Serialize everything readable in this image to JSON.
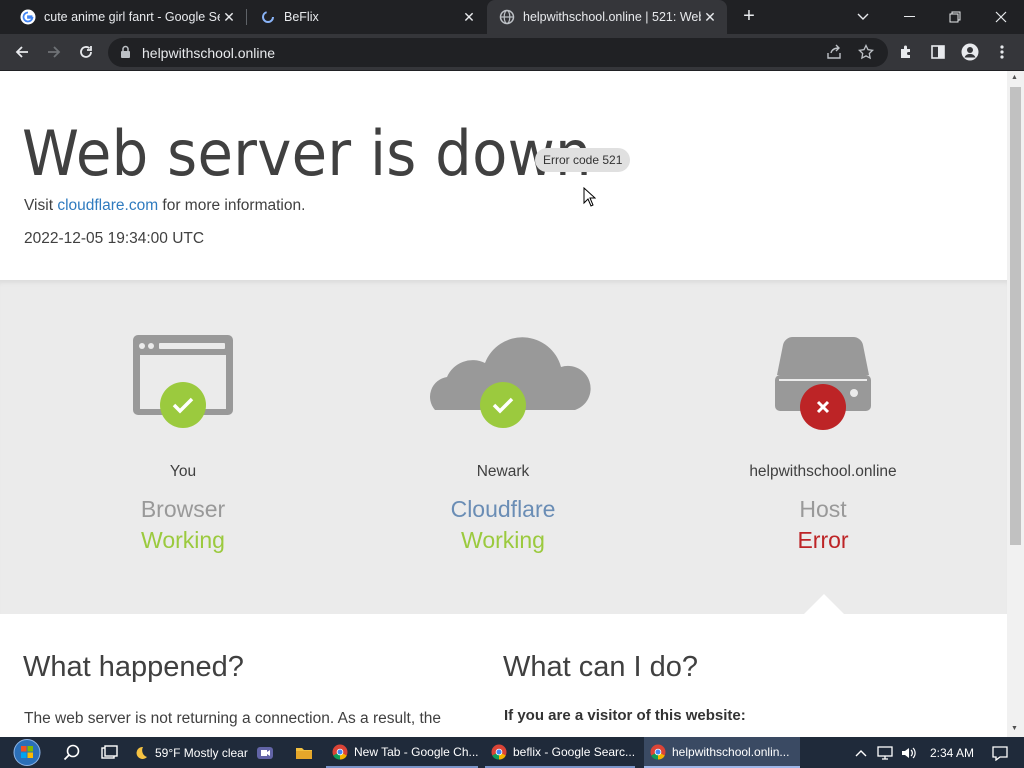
{
  "browser": {
    "tabs": [
      {
        "title": "cute anime girl fanrt - Google Se",
        "close": "✕"
      },
      {
        "title": "BeFlix",
        "close": "✕"
      },
      {
        "title": "helpwithschool.online | 521: Web",
        "close": "✕"
      }
    ],
    "new_tab": "+",
    "url": "helpwithschool.online"
  },
  "page": {
    "heading": "Web server is down",
    "error_badge": "Error code 521",
    "visit_prefix": "Visit ",
    "visit_link": "cloudflare.com",
    "visit_suffix": " for more information.",
    "timestamp": "2022-12-05 19:34:00 UTC",
    "status": [
      {
        "location": "You",
        "kind": "Browser",
        "state": "Working",
        "state_color": "#9bca3e"
      },
      {
        "location": "Newark",
        "kind": "Cloudflare",
        "state": "Working",
        "state_color": "#9bca3e"
      },
      {
        "location": "helpwithschool.online",
        "kind": "Host",
        "state": "Error",
        "state_color": "#bd2426"
      }
    ],
    "what_happened_title": "What happened?",
    "what_happened_text": "The web server is not returning a connection. As a result, the",
    "what_can_i_do_title": "What can I do?",
    "visitor_heading": "If you are a visitor of this website:"
  },
  "taskbar": {
    "weather": "59°F  Mostly clear",
    "apps": [
      {
        "label": "New Tab - Google Ch..."
      },
      {
        "label": "beflix - Google Searc..."
      },
      {
        "label": "helpwithschool.onlin..."
      }
    ],
    "time": "2:34 AM"
  },
  "colors": {
    "ok": "#9bca3e",
    "error": "#bd2426",
    "link": "#2f7bbf"
  }
}
